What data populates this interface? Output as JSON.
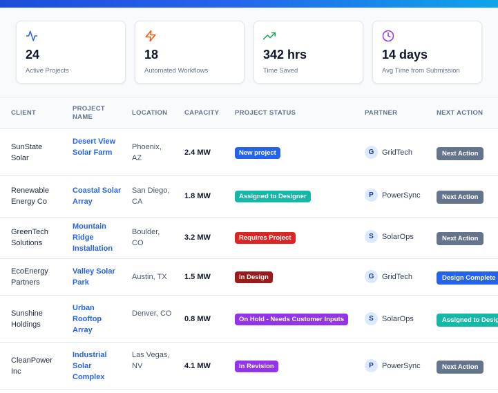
{
  "stats": [
    {
      "value": "24",
      "label": "Active Projects",
      "icon": "activity-icon",
      "color": "#2563eb"
    },
    {
      "value": "18",
      "label": "Automated Workflows",
      "icon": "lightning-icon",
      "color": "#ea580c"
    },
    {
      "value": "342 hrs",
      "label": "Time Saved",
      "icon": "trending-up-icon",
      "color": "#16a34a"
    },
    {
      "value": "14 days",
      "label": "Avg Time from Submission",
      "icon": "clock-icon",
      "color": "#9333ea"
    }
  ],
  "table": {
    "headers": {
      "client": "CLIENT",
      "project_name": "PROJECT NAME",
      "location": "LOCATION",
      "capacity": "CAPACITY",
      "status": "PROJECT STATUS",
      "partner": "PARTNER",
      "action": "NEXT ACTION"
    },
    "rows": [
      {
        "client": "SunState Solar",
        "project": "Desert View Solar Farm",
        "location": "Phoenix, AZ",
        "capacity": "2.4 MW",
        "status": "New project",
        "status_color": "#2563eb",
        "partner_initial": "G",
        "partner": "GridTech",
        "action": "Next Action",
        "action_color": "#64748b"
      },
      {
        "client": "Renewable Energy Co",
        "project": "Coastal Solar Array",
        "location": "San Diego, CA",
        "capacity": "1.8 MW",
        "status": "Assigned to Designer",
        "status_color": "#14b8a6",
        "partner_initial": "P",
        "partner": "PowerSync",
        "action": "Next Action",
        "action_color": "#64748b"
      },
      {
        "client": "GreenTech Solutions",
        "project": "Mountain Ridge Installation",
        "location": "Boulder, CO",
        "capacity": "3.2 MW",
        "status": "Requires Project",
        "status_color": "#dc2626",
        "partner_initial": "S",
        "partner": "SolarOps",
        "action": "Next Action",
        "action_color": "#64748b"
      },
      {
        "client": "EcoEnergy Partners",
        "project": "Valley Solar Park",
        "location": "Austin, TX",
        "capacity": "1.5 MW",
        "status": "In Design",
        "status_color": "#991b1b",
        "partner_initial": "G",
        "partner": "GridTech",
        "action": "Design Complete",
        "action_color": "#2563eb"
      },
      {
        "client": "Sunshine Holdings",
        "project": "Urban Rooftop Array",
        "location": "Denver, CO",
        "capacity": "0.8 MW",
        "status": "On Hold - Needs Customer Inputs",
        "status_color": "#9333ea",
        "partner_initial": "S",
        "partner": "SolarOps",
        "action": "Assigned to Designer",
        "action_color": "#14b8a6"
      },
      {
        "client": "CleanPower Inc",
        "project": "Industrial Solar Complex",
        "location": "Las Vegas, NV",
        "capacity": "4.1 MW",
        "status": "In Revision",
        "status_color": "#9333ea",
        "partner_initial": "P",
        "partner": "PowerSync",
        "action": "Next Action",
        "action_color": "#64748b"
      }
    ]
  }
}
